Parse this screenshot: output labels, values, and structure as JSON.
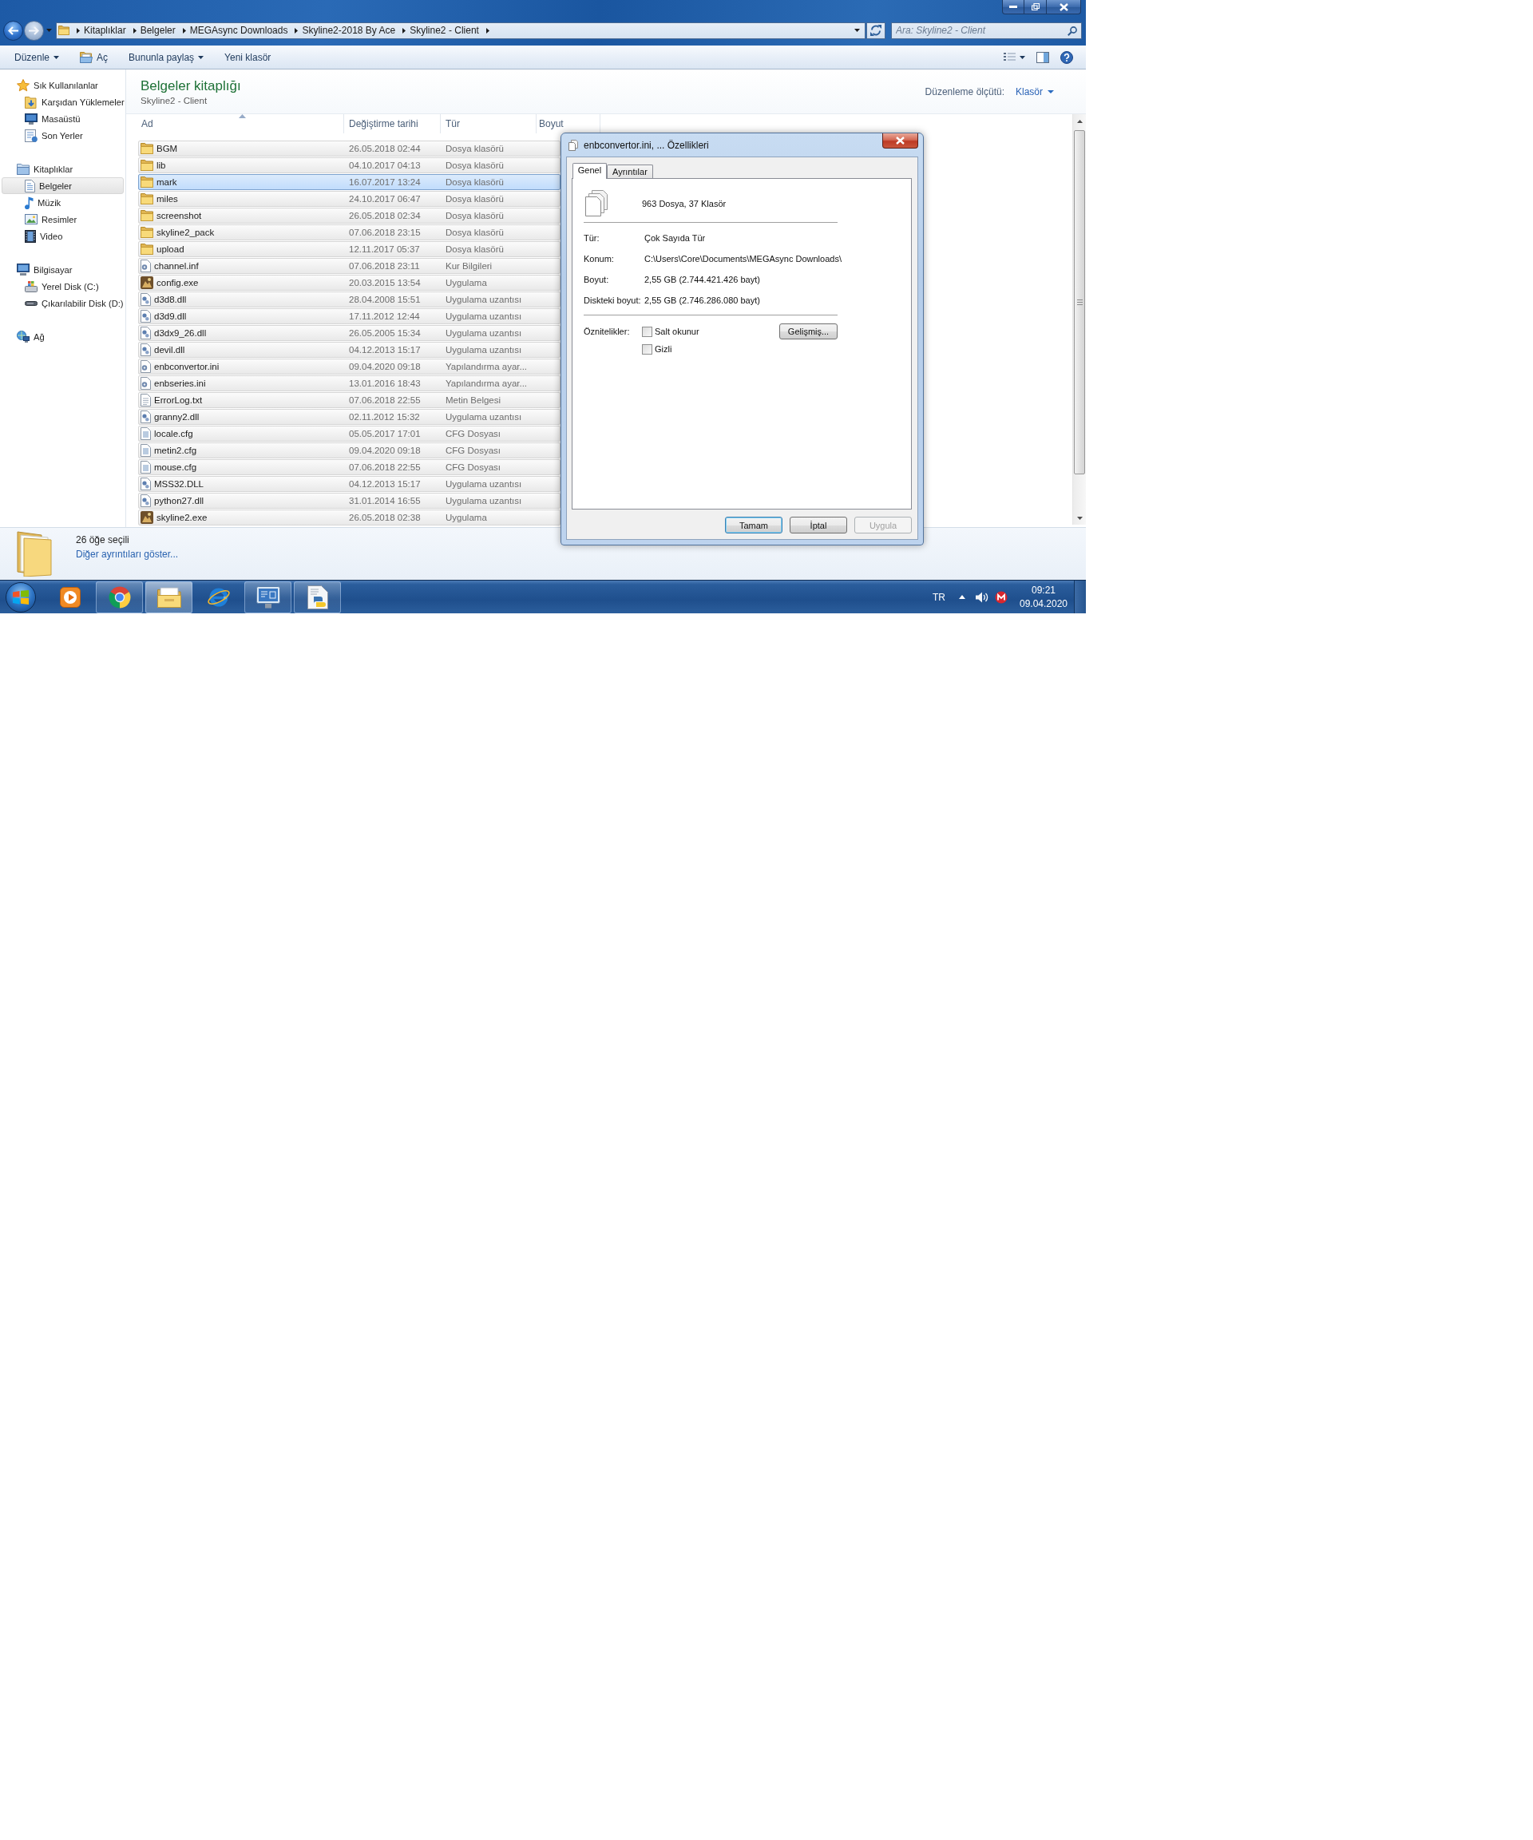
{
  "window": {
    "address_bar": {
      "crumbs": [
        "Kitaplıklar",
        "Belgeler",
        "MEGAsync Downloads",
        "Skyline2-2018 By Ace",
        "Skyline2 - Client"
      ]
    },
    "search": {
      "placeholder": "Ara: Skyline2 - Client"
    }
  },
  "toolbar": {
    "items": [
      {
        "label": "Düzenle",
        "kind": "menu"
      },
      {
        "label": "Aç",
        "kind": "open"
      },
      {
        "label": "Bununla paylaş",
        "kind": "menu"
      },
      {
        "label": "Yeni klasör",
        "kind": "plain"
      }
    ]
  },
  "sidebar": {
    "groups": [
      {
        "label": "Sık Kullanılanlar",
        "kind": "favorites",
        "selected": false,
        "children": [
          {
            "label": "Karşıdan Yüklemeler",
            "kind": "downloads",
            "selected": false
          },
          {
            "label": "Masaüstü",
            "kind": "desktop",
            "selected": false
          },
          {
            "label": "Son Yerler",
            "kind": "recent",
            "selected": false
          }
        ]
      },
      {
        "label": "Kitaplıklar",
        "kind": "libraries",
        "selected": false,
        "children": [
          {
            "label": "Belgeler",
            "kind": "documents",
            "selected": true
          },
          {
            "label": "Müzik",
            "kind": "music",
            "selected": false
          },
          {
            "label": "Resimler",
            "kind": "pictures",
            "selected": false
          },
          {
            "label": "Video",
            "kind": "videos",
            "selected": false
          }
        ]
      },
      {
        "label": "Bilgisayar",
        "kind": "computer",
        "selected": false,
        "children": [
          {
            "label": "Yerel Disk (C:)",
            "kind": "disk",
            "selected": false
          },
          {
            "label": "Çıkarılabilir Disk (D:)",
            "kind": "removable",
            "selected": false
          }
        ]
      },
      {
        "label": "Ağ",
        "kind": "network",
        "selected": false
      }
    ]
  },
  "library": {
    "title": "Belgeler kitaplığı",
    "subtitle": "Skyline2 - Client",
    "arrange_label": "Düzenleme ölçütü:",
    "arrange_value": "Klasör"
  },
  "table": {
    "columns": [
      {
        "label": "Ad",
        "sorted": true
      },
      {
        "label": "Değiştirme tarihi",
        "sorted": false
      },
      {
        "label": "Tür",
        "sorted": false
      },
      {
        "label": "Boyut",
        "sorted": false
      }
    ],
    "rows": [
      {
        "name": "BGM",
        "modified": "26.05.2018 02:44",
        "type": "Dosya klasörü",
        "kind": "folder",
        "selected": true,
        "hovered": false
      },
      {
        "name": "lib",
        "modified": "04.10.2017 04:13",
        "type": "Dosya klasörü",
        "kind": "folder",
        "selected": true,
        "hovered": false
      },
      {
        "name": "mark",
        "modified": "16.07.2017 13:24",
        "type": "Dosya klasörü",
        "kind": "folder",
        "selected": true,
        "hovered": true
      },
      {
        "name": "miles",
        "modified": "24.10.2017 06:47",
        "type": "Dosya klasörü",
        "kind": "folder",
        "selected": true,
        "hovered": false
      },
      {
        "name": "screenshot",
        "modified": "26.05.2018 02:34",
        "type": "Dosya klasörü",
        "kind": "folder",
        "selected": true,
        "hovered": false
      },
      {
        "name": "skyline2_pack",
        "modified": "07.06.2018 23:15",
        "type": "Dosya klasörü",
        "kind": "folder",
        "selected": true,
        "hovered": false
      },
      {
        "name": "upload",
        "modified": "12.11.2017 05:37",
        "type": "Dosya klasörü",
        "kind": "folder",
        "selected": true,
        "hovered": false
      },
      {
        "name": "channel.inf",
        "modified": "07.06.2018 23:11",
        "type": "Kur Bilgileri",
        "kind": "setup",
        "selected": true,
        "hovered": false
      },
      {
        "name": "config.exe",
        "modified": "20.03.2015 13:54",
        "type": "Uygulama",
        "kind": "app",
        "selected": true,
        "hovered": false
      },
      {
        "name": "d3d8.dll",
        "modified": "28.04.2008 15:51",
        "type": "Uygulama uzantısı",
        "kind": "dll",
        "selected": true,
        "hovered": false
      },
      {
        "name": "d3d9.dll",
        "modified": "17.11.2012 12:44",
        "type": "Uygulama uzantısı",
        "kind": "dll",
        "selected": true,
        "hovered": false
      },
      {
        "name": "d3dx9_26.dll",
        "modified": "26.05.2005 15:34",
        "type": "Uygulama uzantısı",
        "kind": "dll",
        "selected": true,
        "hovered": false
      },
      {
        "name": "devil.dll",
        "modified": "04.12.2013 15:17",
        "type": "Uygulama uzantısı",
        "kind": "dll",
        "selected": true,
        "hovered": false
      },
      {
        "name": "enbconvertor.ini",
        "modified": "09.04.2020 09:18",
        "type": "Yapılandırma ayar...",
        "kind": "config",
        "selected": true,
        "hovered": false
      },
      {
        "name": "enbseries.ini",
        "modified": "13.01.2016 18:43",
        "type": "Yapılandırma ayar...",
        "kind": "config",
        "selected": true,
        "hovered": false
      },
      {
        "name": "ErrorLog.txt",
        "modified": "07.06.2018 22:55",
        "type": "Metin Belgesi",
        "kind": "text",
        "selected": true,
        "hovered": false
      },
      {
        "name": "granny2.dll",
        "modified": "02.11.2012 15:32",
        "type": "Uygulama uzantısı",
        "kind": "dll",
        "selected": true,
        "hovered": false
      },
      {
        "name": "locale.cfg",
        "modified": "05.05.2017 17:01",
        "type": "CFG Dosyası",
        "kind": "cfg",
        "selected": true,
        "hovered": false
      },
      {
        "name": "metin2.cfg",
        "modified": "09.04.2020 09:18",
        "type": "CFG Dosyası",
        "kind": "cfg",
        "selected": true,
        "hovered": false
      },
      {
        "name": "mouse.cfg",
        "modified": "07.06.2018 22:55",
        "type": "CFG Dosyası",
        "kind": "cfg",
        "selected": true,
        "hovered": false
      },
      {
        "name": "MSS32.DLL",
        "modified": "04.12.2013 15:17",
        "type": "Uygulama uzantısı",
        "kind": "dll",
        "selected": true,
        "hovered": false
      },
      {
        "name": "python27.dll",
        "modified": "31.01.2014 16:55",
        "type": "Uygulama uzantısı",
        "kind": "dll",
        "selected": true,
        "hovered": false
      },
      {
        "name": "skyline2.exe",
        "modified": "26.05.2018 02:38",
        "type": "Uygulama",
        "kind": "app",
        "selected": true,
        "hovered": false
      }
    ]
  },
  "details": {
    "summary": "26 öğe seçili",
    "link": "Diğer ayrıntıları göster..."
  },
  "dialog": {
    "title": "enbconvertor.ini, ... Özellikleri",
    "tabs": [
      {
        "label": "Genel",
        "selected": true
      },
      {
        "label": "Ayrıntılar",
        "selected": false
      }
    ],
    "summary": "963 Dosya, 37 Klasör",
    "properties": [
      {
        "label": "Tür:",
        "value": "Çok Sayıda Tür"
      },
      {
        "label": "Konum:",
        "value": "C:\\Users\\Core\\Documents\\MEGAsync Downloads\\"
      },
      {
        "label": "Boyut:",
        "value": "2,55 GB (2.744.421.426 bayt)"
      },
      {
        "label": "Diskteki boyut:",
        "value": "2,55 GB (2.746.286.080 bayt)"
      }
    ],
    "attributes_label": "Öznitelikler:",
    "attributes": [
      {
        "label": "Salt okunur",
        "checked": false
      },
      {
        "label": "Gizli",
        "checked": false
      }
    ],
    "advanced_button": "Gelişmiş...",
    "buttons": [
      {
        "label": "Tamam",
        "default": true,
        "disabled": false
      },
      {
        "label": "İptal",
        "default": false,
        "disabled": false
      },
      {
        "label": "Uygula",
        "default": false,
        "disabled": true
      }
    ]
  },
  "taskbar": {
    "apps": [
      {
        "kind": "player",
        "running": false,
        "active": false
      },
      {
        "kind": "browser",
        "running": true,
        "active": false
      },
      {
        "kind": "explorer",
        "running": true,
        "active": true
      },
      {
        "kind": "web",
        "running": false,
        "active": false
      },
      {
        "kind": "remote",
        "running": true,
        "active": false
      },
      {
        "kind": "script",
        "running": true,
        "active": false
      }
    ],
    "language": "TR",
    "time": "09:21",
    "date": "09.04.2020"
  }
}
